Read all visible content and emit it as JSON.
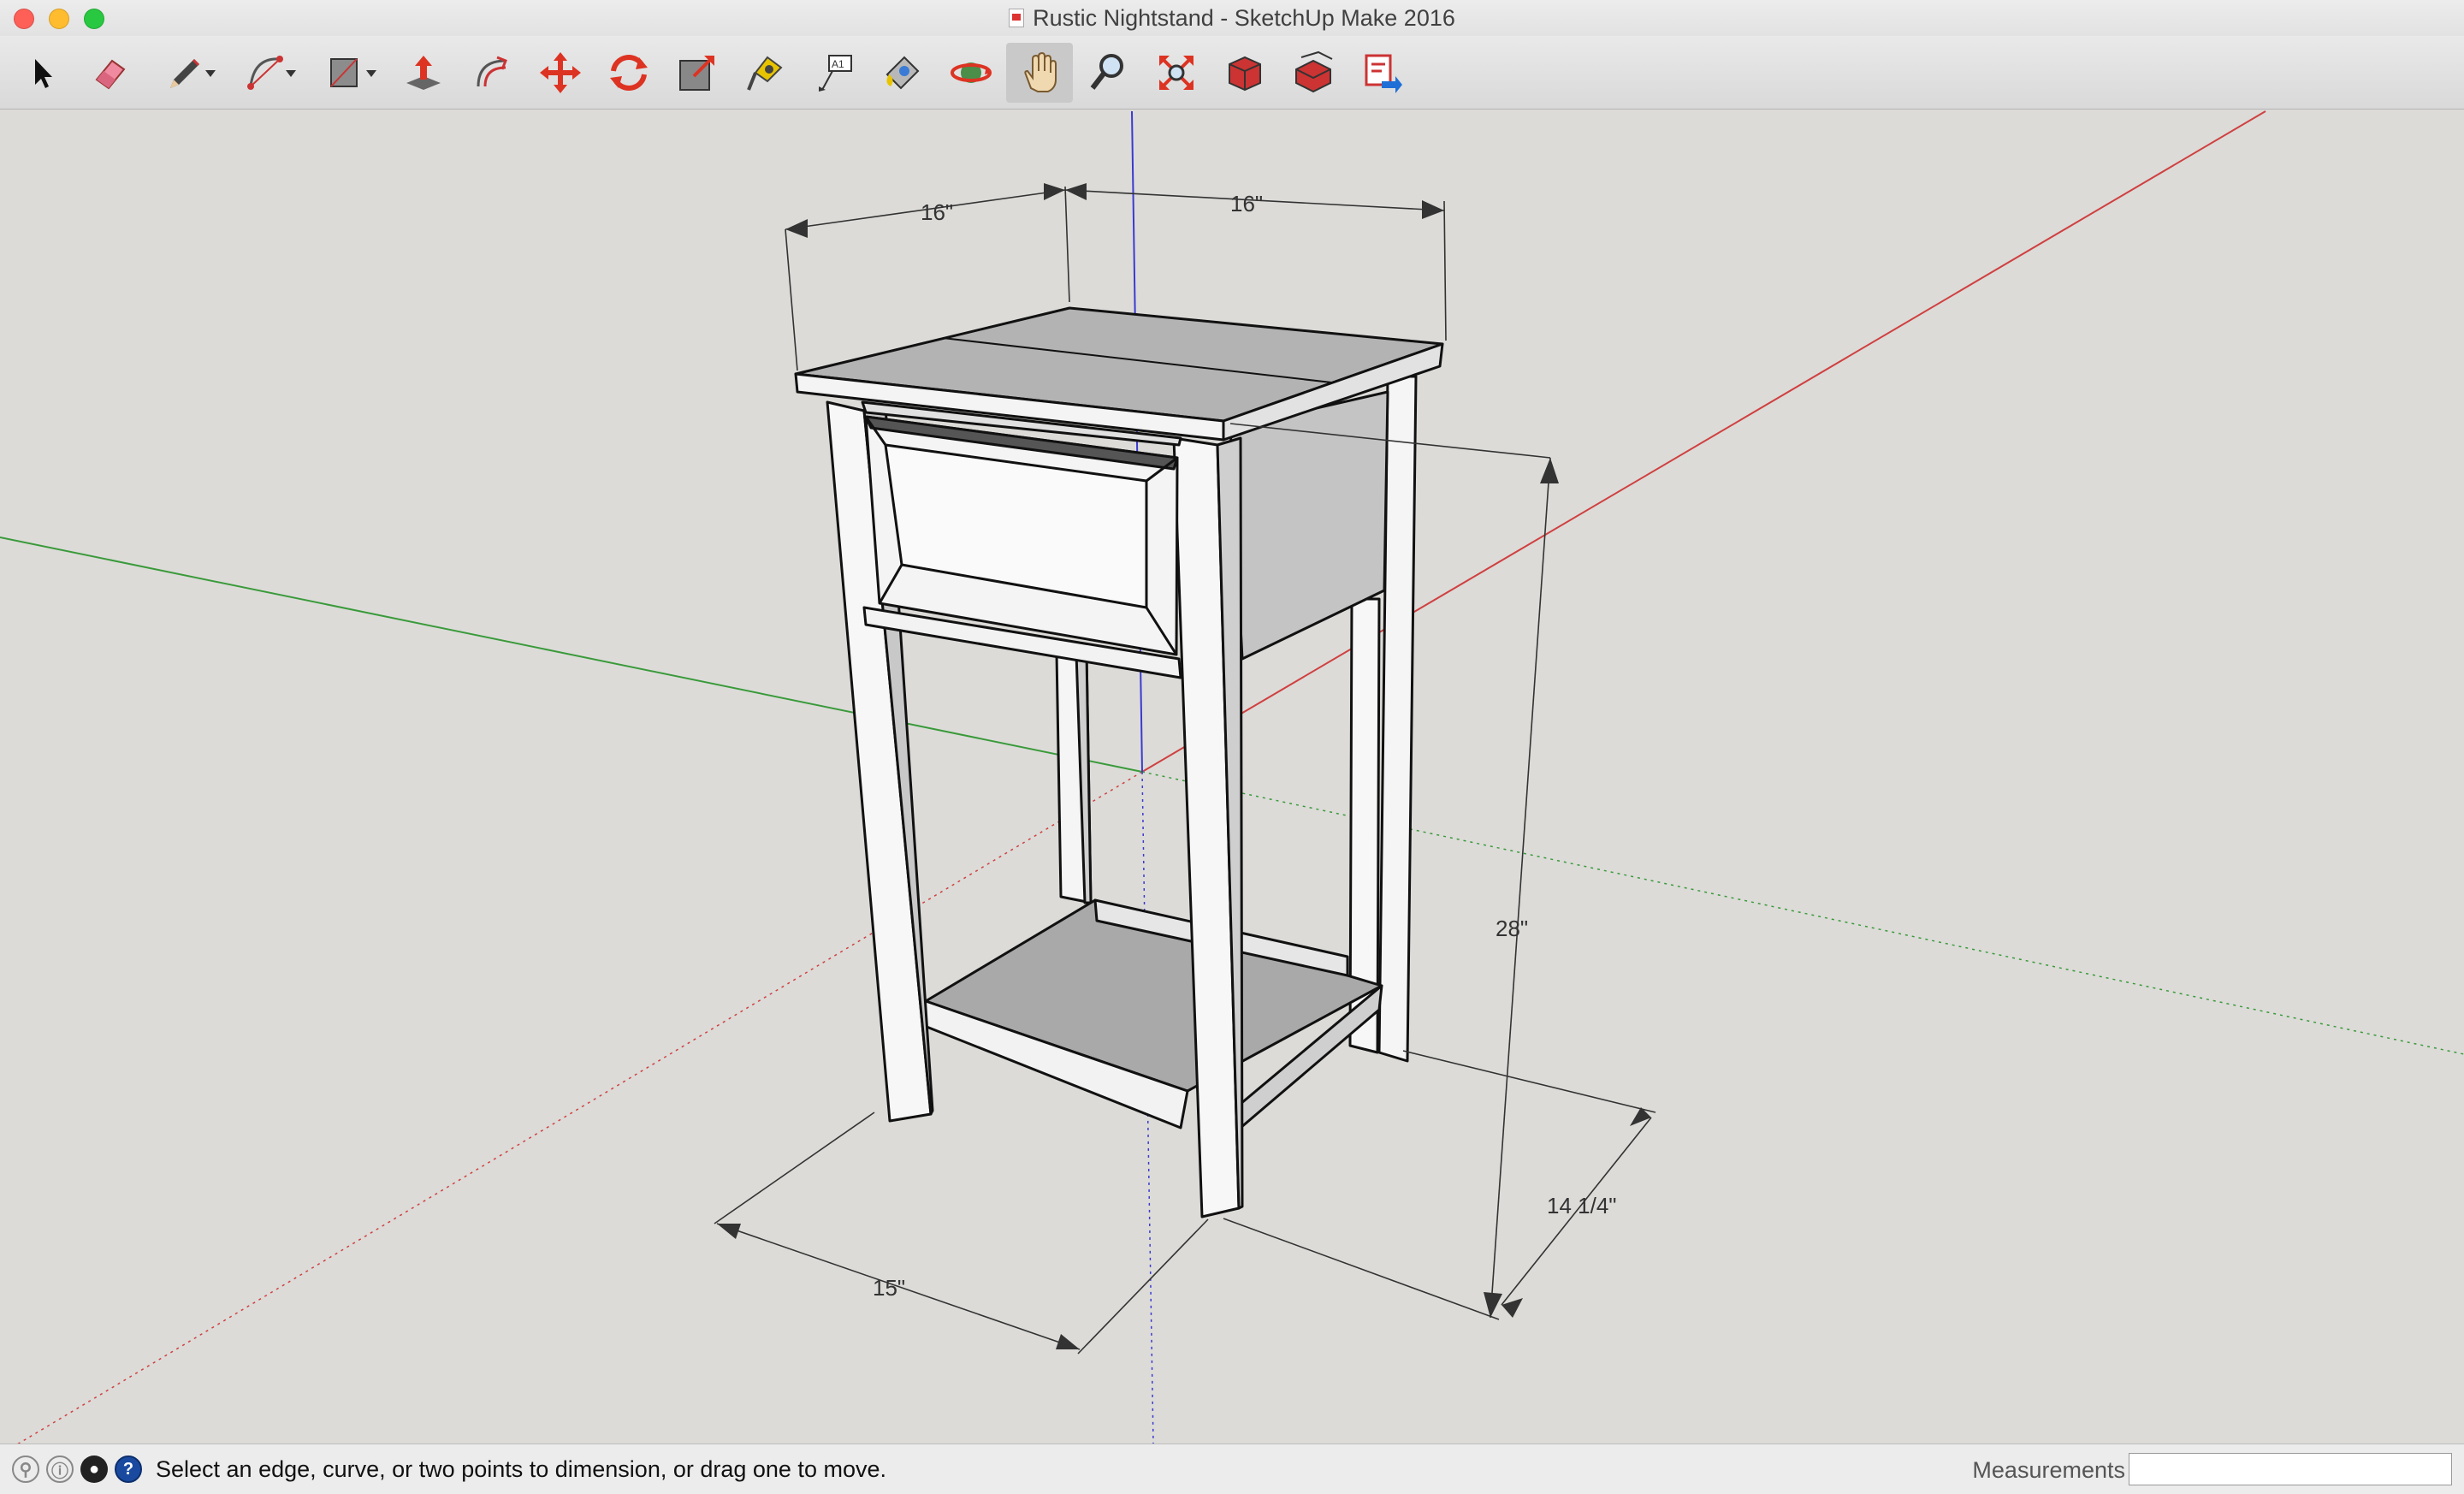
{
  "window": {
    "title": "Rustic Nightstand - SketchUp Make 2016"
  },
  "toolbar": {
    "tools": [
      {
        "name": "select-tool",
        "icon": "arrow-icon"
      },
      {
        "name": "eraser-tool",
        "icon": "eraser-icon"
      },
      {
        "name": "line-tool",
        "icon": "pencil-icon",
        "dropdown": true
      },
      {
        "name": "arc-tool",
        "icon": "arc-icon",
        "dropdown": true
      },
      {
        "name": "rectangle-tool",
        "icon": "rectangle-icon",
        "dropdown": true
      },
      {
        "name": "push-pull-tool",
        "icon": "push-pull-icon"
      },
      {
        "name": "offset-tool",
        "icon": "offset-icon"
      },
      {
        "name": "move-tool",
        "icon": "move-icon"
      },
      {
        "name": "rotate-tool",
        "icon": "rotate-icon"
      },
      {
        "name": "scale-tool",
        "icon": "scale-icon"
      },
      {
        "name": "tape-measure-tool",
        "icon": "tape-measure-icon"
      },
      {
        "name": "text-tool",
        "icon": "text-icon"
      },
      {
        "name": "paint-bucket-tool",
        "icon": "paint-bucket-icon"
      },
      {
        "name": "orbit-tool",
        "icon": "orbit-icon"
      },
      {
        "name": "pan-tool",
        "icon": "hand-icon",
        "active": true
      },
      {
        "name": "zoom-tool",
        "icon": "magnifier-icon"
      },
      {
        "name": "zoom-extents-tool",
        "icon": "zoom-extents-icon"
      },
      {
        "name": "warehouse-tool",
        "icon": "warehouse-icon"
      },
      {
        "name": "share-model-tool",
        "icon": "share-model-icon"
      },
      {
        "name": "extension-warehouse-tool",
        "icon": "extension-warehouse-icon"
      }
    ]
  },
  "model": {
    "dimensions": {
      "top_left_width": "16\"",
      "top_right_depth": "16\"",
      "height": "28\"",
      "bottom_depth": "14 1/4\"",
      "bottom_width": "15\""
    },
    "axis_colors": {
      "red": "#d04040",
      "green": "#3a9a3a",
      "blue": "#3a3ad0"
    }
  },
  "statusbar": {
    "message": "Select an edge, curve, or two points to dimension, or drag one to move.",
    "measurements_label": "Measurements",
    "measurements_value": ""
  }
}
